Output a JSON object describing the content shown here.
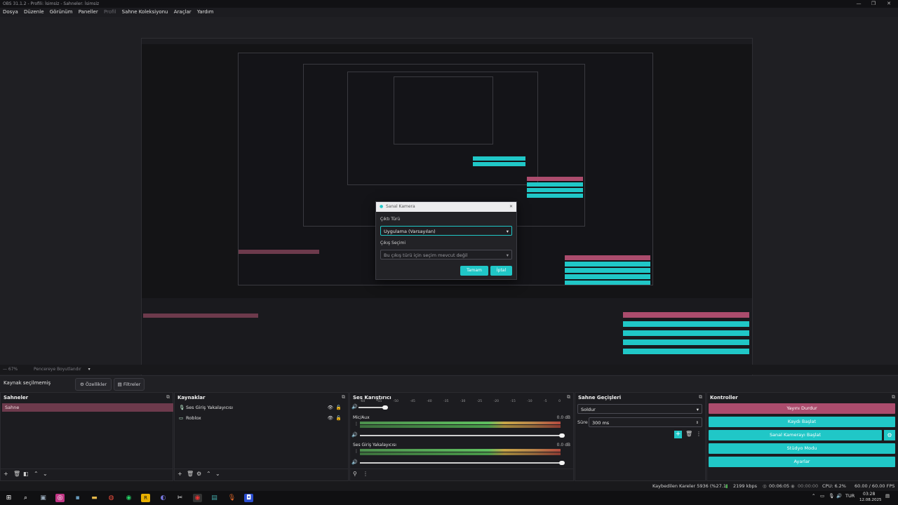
{
  "window": {
    "title": "OBS 31.1.2 - Profili: İsimsiz - Sahneler: İsimsiz",
    "controls": [
      "—",
      "❐",
      "✕"
    ]
  },
  "menu": [
    "Dosya",
    "Düzenle",
    "Görünüm",
    "Paneller",
    "Profil",
    "Sahne Koleksiyonu",
    "Araçlar",
    "Yardım"
  ],
  "preview_bar": {
    "zoom": "67%",
    "mode": "Pencereye Boyutlandır"
  },
  "source_bar": {
    "label": "Kaynak seçilmemiş",
    "properties": "Özellikler",
    "filters": "Filtreler"
  },
  "scenes": {
    "title": "Sahneler",
    "items": [
      "Sahne"
    ]
  },
  "sources": {
    "title": "Kaynaklar",
    "items": [
      {
        "name": "Ses Giriş Yakalayıcısı",
        "icon": "microphone-icon"
      },
      {
        "name": "Roblox",
        "icon": "monitor-icon"
      }
    ]
  },
  "mixer": {
    "title": "Ses Karıştırıcı",
    "ticks": [
      "-60",
      "-55",
      "-50",
      "-45",
      "-40",
      "-35",
      "-30",
      "-25",
      "-20",
      "-15",
      "-10",
      "-5",
      "0"
    ],
    "channels": [
      {
        "name": "Mic/Aux",
        "db": "0.0 dB",
        "level": 1.0
      },
      {
        "name": "Ses Giriş Yakalayıcısı",
        "db": "0.0 dB",
        "level": 1.0
      }
    ]
  },
  "transitions": {
    "title": "Sahne Geçişleri",
    "selected": "Soldur",
    "duration_label": "Süre",
    "duration": "300 ms"
  },
  "controls": {
    "title": "Kontroller",
    "stop_stream": "Yayını Durdur",
    "start_recording": "Kaydı Başlat",
    "start_virtualcam": "Sanal Kamerayı Başlat",
    "studio_mode": "Stüdyo Modu",
    "settings": "Ayarlar"
  },
  "dialog": {
    "title": "Sanal Kamera",
    "output_type_label": "Çıktı Türü",
    "output_type_value": "Uygulama (Varsayılan)",
    "output_selection_label": "Çıkış Seçimi",
    "output_selection_value": "Bu çıkış türü için seçim mevcut değil",
    "ok": "Tamam",
    "cancel": "İptal"
  },
  "status": {
    "dropped": "Kaybedilen Kareler 5936 (%27.1)",
    "bitrate": "2199 kbps",
    "stream_time": "00:06:05",
    "rec_time": "00:00:00",
    "cpu": "CPU: 6.2%",
    "fps": "60.00 / 60.00 FPS"
  },
  "taskbar": {
    "lang": "TUR",
    "time": "03:28",
    "date": "12.08.2025"
  },
  "colors": {
    "accent": "#20c7c7",
    "stop": "#ab4c6d",
    "scene_sel": "#6d3a4c"
  }
}
